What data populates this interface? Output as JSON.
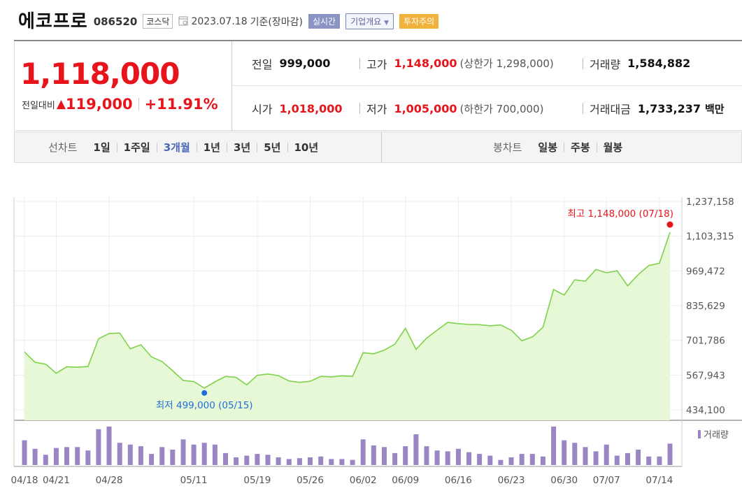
{
  "header": {
    "name": "에코프로",
    "code": "086520",
    "market": "코스닥",
    "date": "2023.07.18",
    "basis": "기준(장마감)",
    "tag_realtime": "실시간",
    "tag_company": "기업개요",
    "tag_warning": "투자주의"
  },
  "quote": {
    "price": "1,118,000",
    "change_label": "전일대비",
    "change_value": "119,000",
    "change_percent": "+11.91%",
    "prev_close_label": "전일",
    "prev_close": "999,000",
    "high_label": "고가",
    "high": "1,148,000",
    "upper_limit": "(상한가 1,298,000)",
    "volume_label": "거래량",
    "volume": "1,584,882",
    "open_label": "시가",
    "open": "1,018,000",
    "low_label": "저가",
    "low": "1,005,000",
    "lower_limit": "(하한가 700,000)",
    "amount_label": "거래대금",
    "amount": "1,733,237",
    "amount_unit": "백만"
  },
  "period_bar": {
    "line_label": "선차트",
    "line_options": [
      "1일",
      "1주일",
      "3개월",
      "1년",
      "3년",
      "5년",
      "10년"
    ],
    "line_active": "3개월",
    "candle_label": "봉차트",
    "candle_options": [
      "일봉",
      "주봉",
      "월봉"
    ]
  },
  "colors": {
    "up": "#e8141b",
    "line": "#7fd14c",
    "fill": "#e6f8d6",
    "volume_bar": "#9a86c4",
    "low_marker": "#1f6fd6",
    "active_tab": "#4a69b8"
  },
  "chart_data": {
    "type": "area",
    "y_ticks": [
      "1,237,158",
      "1,103,315",
      "969,472",
      "835,629",
      "701,786",
      "567,943",
      "434,100"
    ],
    "ylim": [
      434100,
      1237158
    ],
    "x_tick_labels": [
      "04/18",
      "04/21",
      "04/28",
      "05/11",
      "05/19",
      "05/26",
      "06/02",
      "06/09",
      "06/16",
      "06/23",
      "06/30",
      "07/07",
      "07/14"
    ],
    "x_tick_indices": [
      0,
      3,
      8,
      16,
      22,
      27,
      32,
      36,
      41,
      46,
      51,
      55,
      60
    ],
    "prices": [
      657000,
      617000,
      610000,
      575000,
      600000,
      598000,
      601000,
      708000,
      728000,
      730000,
      669000,
      685000,
      638000,
      620000,
      585000,
      547000,
      543000,
      518000,
      542000,
      563000,
      559000,
      530000,
      567000,
      572000,
      566000,
      545000,
      540000,
      544000,
      563000,
      561000,
      565000,
      563000,
      654000,
      650000,
      664000,
      687000,
      748000,
      667000,
      710000,
      741000,
      771000,
      766000,
      763000,
      762000,
      758000,
      761000,
      741000,
      700000,
      715000,
      752000,
      898000,
      876000,
      935000,
      930000,
      975000,
      962000,
      970000,
      912000,
      955000,
      990000,
      999000,
      1118000
    ],
    "volume": [
      29,
      19,
      12,
      20,
      21,
      21,
      17,
      42,
      45,
      26,
      24,
      22,
      13,
      21,
      18,
      30,
      24,
      26,
      24,
      14,
      9,
      11,
      13,
      12,
      9,
      7,
      8,
      9,
      10,
      7,
      7,
      6,
      30,
      23,
      21,
      14,
      22,
      36,
      22,
      17,
      16,
      19,
      15,
      13,
      11,
      6,
      9,
      13,
      13,
      10,
      45,
      29,
      26,
      21,
      16,
      24,
      11,
      14,
      18,
      10,
      10,
      25
    ],
    "volume_label": "거래량",
    "max_annotation": "최고 1,148,000 (07/18)",
    "max_value": 1148000,
    "max_index": 61,
    "min_annotation": "최저 499,000 (05/15)",
    "min_value": 499000,
    "min_index": 17
  }
}
